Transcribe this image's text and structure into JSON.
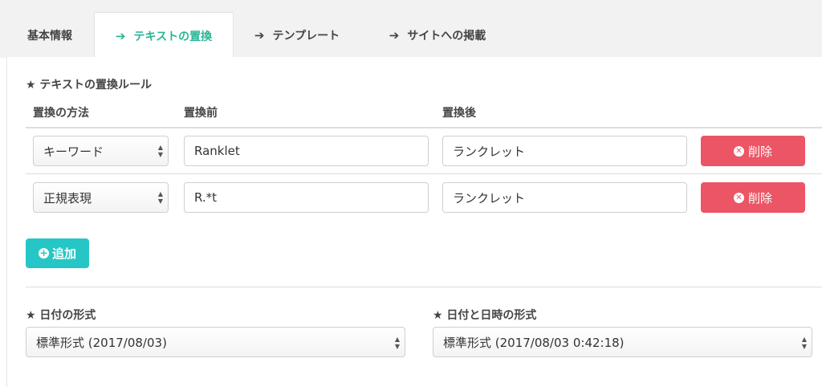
{
  "tabs": [
    {
      "label": "基本情報"
    },
    {
      "label": "テキストの置換"
    },
    {
      "label": "テンプレート"
    },
    {
      "label": "サイトへの掲載"
    }
  ],
  "replace_rules": {
    "title": "★ テキストの置換ルール",
    "columns": {
      "method": "置換の方法",
      "before": "置換前",
      "after": "置換後"
    },
    "rows": [
      {
        "method": "キーワード",
        "before": "Ranklet",
        "after": "ランクレット",
        "delete_label": "削除"
      },
      {
        "method": "正規表現",
        "before": "R.*t",
        "after": "ランクレット",
        "delete_label": "削除"
      }
    ],
    "add_label": "追加"
  },
  "date_format": {
    "title": "★ 日付の形式",
    "selected": "標準形式 (2017/08/03)"
  },
  "datetime_format": {
    "title": "★ 日付と日時の形式",
    "selected": "標準形式 (2017/08/03 0:42:18)"
  },
  "colors": {
    "active_tab": "#2bb594",
    "delete_button": "#ec5565",
    "add_button": "#27c6c6"
  }
}
